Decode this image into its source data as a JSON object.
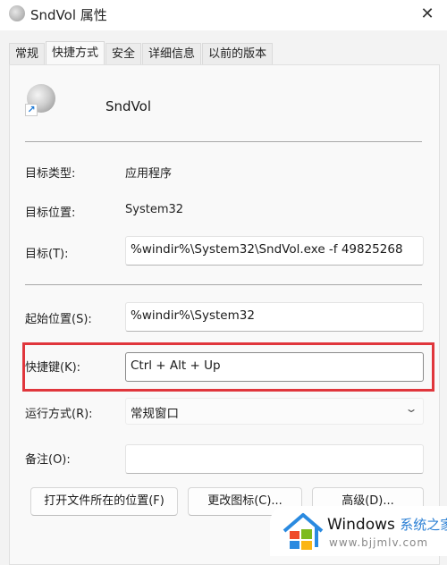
{
  "window": {
    "title": "SndVol 属性",
    "close_icon": "close-icon"
  },
  "tabs": [
    {
      "label": "常规",
      "active": false
    },
    {
      "label": "快捷方式",
      "active": true
    },
    {
      "label": "安全",
      "active": false
    },
    {
      "label": "详细信息",
      "active": false
    },
    {
      "label": "以前的版本",
      "active": false
    }
  ],
  "shortcut": {
    "icon": "speaker-shortcut-icon",
    "name": "SndVol",
    "target_type_label": "目标类型:",
    "target_type_value": "应用程序",
    "target_location_label": "目标位置:",
    "target_location_value": "System32",
    "target_label": "目标(T):",
    "target_value": "%windir%\\System32\\SndVol.exe -f 49825268",
    "start_in_label": "起始位置(S):",
    "start_in_value": "%windir%\\System32",
    "hotkey_label": "快捷键(K):",
    "hotkey_value": "Ctrl + Alt + Up",
    "run_label": "运行方式(R):",
    "run_value": "常规窗口",
    "comment_label": "备注(O):",
    "comment_value": ""
  },
  "buttons": {
    "open_location": "打开文件所在的位置(F)",
    "change_icon": "更改图标(C)...",
    "advanced": "高级(D)..."
  },
  "highlight_color": "#e0363c",
  "watermark": {
    "title": "Windows",
    "title_cn": "系统之家",
    "url": "www.bjjmlv.com"
  }
}
